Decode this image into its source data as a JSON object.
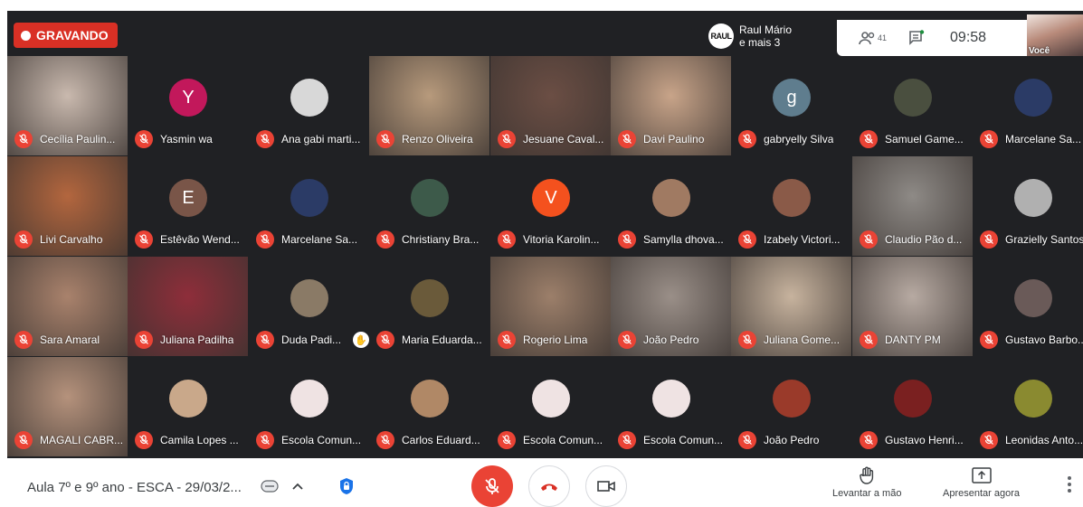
{
  "header": {
    "recording_label": "GRAVANDO",
    "presenter_logo": "RAUL",
    "presenter_name": "Raul Mário",
    "presenter_more": "e mais 3",
    "participant_count": "41",
    "clock": "09:58",
    "self_label": "Você"
  },
  "participants": [
    {
      "name": "Cecília Paulin...",
      "bg": "#c9b9ae",
      "avatar": "video"
    },
    {
      "name": "Yasmin wa",
      "avatar": "letter",
      "letter": "Y",
      "color": "#c2185b"
    },
    {
      "name": "Ana gabi marti...",
      "avatar": "photo",
      "color": "#d8d8d8"
    },
    {
      "name": "Renzo Oliveira",
      "bg": "#b79a7c",
      "avatar": "video"
    },
    {
      "name": "Jesuane Caval...",
      "bg": "#6b4e44",
      "avatar": "video"
    },
    {
      "name": "Davi Paulino",
      "bg": "#c8a489",
      "avatar": "video"
    },
    {
      "name": "gabryelly Silva",
      "avatar": "letter",
      "letter": "g",
      "color": "#5f7d8e"
    },
    {
      "name": "Samuel Game...",
      "avatar": "photo",
      "color": "#4a4f3f"
    },
    {
      "name": "Marcelane Sa...",
      "avatar": "photo",
      "color": "#2b3b66"
    },
    {
      "name": "Livi Carvalho",
      "bg": "#b3663e",
      "avatar": "video"
    },
    {
      "name": "Estêvão Wend...",
      "avatar": "letter",
      "letter": "E",
      "color": "#795548"
    },
    {
      "name": "Marcelane Sa...",
      "avatar": "photo",
      "color": "#2b3b66"
    },
    {
      "name": "Christiany Bra...",
      "avatar": "photo",
      "color": "#3d5a4a"
    },
    {
      "name": "Vitoria Karolin...",
      "avatar": "letter",
      "letter": "V",
      "color": "#f4511e"
    },
    {
      "name": "Samylla dhova...",
      "avatar": "photo",
      "color": "#a07a62"
    },
    {
      "name": "Izabely Victori...",
      "avatar": "photo",
      "color": "#8a5a48"
    },
    {
      "name": "Claudio Pão d...",
      "bg": "#8e8a86",
      "avatar": "video"
    },
    {
      "name": "Grazielly Santos",
      "avatar": "photo",
      "color": "#b0b0b0"
    },
    {
      "name": "Sara Amaral",
      "bg": "#a9826c",
      "avatar": "video"
    },
    {
      "name": "Juliana Padilha",
      "bg": "#8e2e3a",
      "avatar": "video"
    },
    {
      "name": "Duda Padi...",
      "avatar": "photo",
      "color": "#8a7a66",
      "hand": true
    },
    {
      "name": "Maria Eduarda...",
      "avatar": "photo",
      "color": "#6a5a3a"
    },
    {
      "name": "Rogerio Lima",
      "bg": "#9c7f6a",
      "avatar": "video"
    },
    {
      "name": "João Pedro",
      "bg": "#9a8f88",
      "avatar": "video"
    },
    {
      "name": "Juliana Gome...",
      "bg": "#c7b39e",
      "avatar": "video"
    },
    {
      "name": "DANTY PM",
      "bg": "#b7aaa2",
      "avatar": "video"
    },
    {
      "name": "Gustavo Barbo...",
      "avatar": "photo",
      "color": "#6a5a58"
    },
    {
      "name": "MAGALI CABR...",
      "bg": "#b5927c",
      "avatar": "video"
    },
    {
      "name": "Camila Lopes ...",
      "avatar": "photo",
      "color": "#c9a88a"
    },
    {
      "name": "Escola Comun...",
      "avatar": "photo",
      "color": "#efe3e3"
    },
    {
      "name": "Carlos Eduard...",
      "avatar": "photo",
      "color": "#b08866"
    },
    {
      "name": "Escola Comun...",
      "avatar": "photo",
      "color": "#efe3e3"
    },
    {
      "name": "Escola Comun...",
      "avatar": "photo",
      "color": "#efe3e3"
    },
    {
      "name": "João Pedro",
      "avatar": "photo",
      "color": "#9a3a2a"
    },
    {
      "name": "Gustavo Henri...",
      "avatar": "photo",
      "color": "#7a2020"
    },
    {
      "name": "Leonidas Anto...",
      "avatar": "photo",
      "color": "#8a8a30"
    }
  ],
  "footer": {
    "meeting_title": "Aula 7º e 9º ano - ESCA - 29/03/2...",
    "raise_hand_label": "Levantar a mão",
    "present_label": "Apresentar agora"
  },
  "icons": {
    "recording": "record-dot-icon",
    "people": "people-icon",
    "chat": "chat-icon",
    "mic_off": "mic-off-icon",
    "hand": "raise-hand-icon",
    "present": "present-icon",
    "end_call": "end-call-icon",
    "camera": "camera-icon",
    "captions": "captions-icon",
    "chevron": "chevron-up-icon",
    "security": "shield-icon",
    "more": "more-vertical-icon"
  },
  "colors": {
    "background": "#202124",
    "recording": "#d93025",
    "mic_off": "#ea4335",
    "accent": "#1a73e8"
  }
}
